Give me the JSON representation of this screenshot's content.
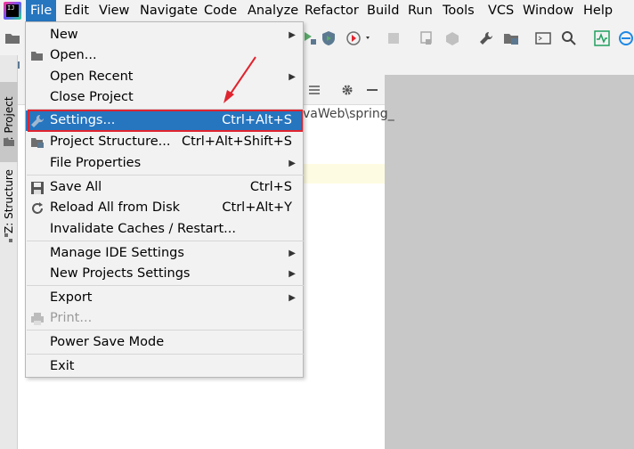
{
  "menubar": {
    "items": [
      "File",
      "Edit",
      "View",
      "Navigate",
      "Code",
      "Analyze",
      "Refactor",
      "Build",
      "Run",
      "Tools",
      "VCS",
      "Window",
      "Help"
    ]
  },
  "left_strip": {
    "project_tab": "1: Project",
    "structure_tab": "Z: Structure"
  },
  "background": {
    "path_fragment": "vaWeb\\spring_"
  },
  "file_menu": {
    "items": [
      {
        "label": "New",
        "shortcut": "",
        "submenu": true
      },
      {
        "label": "Open...",
        "shortcut": "",
        "submenu": false
      },
      {
        "label": "Open Recent",
        "shortcut": "",
        "submenu": true
      },
      {
        "label": "Close Project",
        "shortcut": "",
        "submenu": false
      },
      {
        "label": "Settings...",
        "shortcut": "Ctrl+Alt+S",
        "submenu": false
      },
      {
        "label": "Project Structure...",
        "shortcut": "Ctrl+Alt+Shift+S",
        "submenu": false
      },
      {
        "label": "File Properties",
        "shortcut": "",
        "submenu": true
      },
      {
        "label": "Save All",
        "shortcut": "Ctrl+S",
        "submenu": false
      },
      {
        "label": "Reload All from Disk",
        "shortcut": "Ctrl+Alt+Y",
        "submenu": false
      },
      {
        "label": "Invalidate Caches / Restart...",
        "shortcut": "",
        "submenu": false
      },
      {
        "label": "Manage IDE Settings",
        "shortcut": "",
        "submenu": true
      },
      {
        "label": "New Projects Settings",
        "shortcut": "",
        "submenu": true
      },
      {
        "label": "Export",
        "shortcut": "",
        "submenu": true
      },
      {
        "label": "Print...",
        "shortcut": "",
        "submenu": false
      },
      {
        "label": "Power Save Mode",
        "shortcut": "",
        "submenu": false
      },
      {
        "label": "Exit",
        "shortcut": "",
        "submenu": false
      }
    ],
    "submenu_arrow": "▶"
  },
  "colors": {
    "selection": "#2675bf",
    "annotation_red": "#e0242f"
  }
}
